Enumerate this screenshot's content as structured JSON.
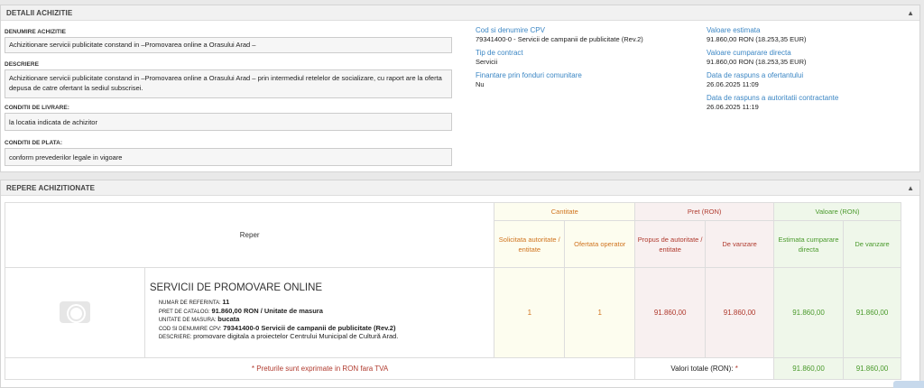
{
  "detalii": {
    "title": "DETALII ACHIZITIE",
    "denumire_label": "DENUMIRE ACHIZITIE",
    "denumire_value": "Achizitionare servicii publicitate constand in –Promovarea online a Orasului Arad –",
    "descriere_label": "DESCRIERE",
    "descriere_value": "Achizitionare servicii publicitate constand in –Promovarea online a Orasului Arad – prin intermediul retelelor de socializare, cu raport are la oferta depusa de catre ofertant la sediul subscrisei.",
    "livrare_label": "CONDITII DE LIVRARE:",
    "livrare_value": "la locatia indicata de achizitor",
    "plata_label": "CONDITII DE PLATA:",
    "plata_value": "conform prevederilor legale in vigoare",
    "cpv_label": "Cod si denumire CPV",
    "cpv_value": "79341400-0 - Servicii de campanii de publicitate (Rev.2)",
    "tip_label": "Tip de contract",
    "tip_value": "Servicii",
    "fonduri_label": "Finantare prin fonduri comunitare",
    "fonduri_value": "Nu",
    "val_est_label": "Valoare estimata",
    "val_est_value": "91.860,00  RON (18.253,35  EUR)",
    "val_cump_label": "Valoare cumparare directa",
    "val_cump_value": "91.860,00  RON (18.253,35  EUR)",
    "data_oferta_label": "Data de raspuns a ofertantului",
    "data_oferta_value": "26.06.2025 11:09",
    "data_aut_label": "Data de raspuns a autoritatii contractante",
    "data_aut_value": "26.06.2025 11:19"
  },
  "repere": {
    "title": "REPERE ACHIZITIONATE",
    "col_reper": "Reper",
    "grp_cantitate": "Cantitate",
    "grp_pret": "Pret (RON)",
    "grp_valoare": "Valoare (RON)",
    "sub_solicitata": "Solicitata autoritate / entitate",
    "sub_ofertata": "Ofertata operator",
    "sub_propus": "Propus de autoritate / entitate",
    "sub_vanzare_pret": "De vanzare",
    "sub_estimata": "Estimata cumparare directa",
    "sub_vanzare_val": "De vanzare",
    "item": {
      "name": "SERVICII DE PROMOVARE ONLINE",
      "ref_label": "NUMAR DE REFERINTA:",
      "ref_value": "11",
      "pret_label": "PRET DE CATALOG:",
      "pret_value": "91.860,00  RON / Unitate de masura",
      "um_label": "UNITATE DE MASURA:",
      "um_value": "bucata",
      "cpv_label": "COD SI DENUMIRE CPV:",
      "cpv_value": "79341400-0 Servicii de campanii de publicitate (Rev.2)",
      "desc_label": "DESCRIERE:",
      "desc_value": "promovare digitala a proiectelor Centrului Municipal de Cultură Arad.",
      "solicitata": "1",
      "ofertata": "1",
      "pret_propus": "91.860,00",
      "pret_vanzare": "91.860,00",
      "val_estimata": "91.860,00",
      "val_vanzare": "91.860,00"
    },
    "footer_note": "* Preturile sunt exprimate in RON fara TVA",
    "total_label": "Valori totale (RON):",
    "total_star": "*",
    "total_estimata": "91.860,00",
    "total_vanzare": "91.860,00"
  }
}
